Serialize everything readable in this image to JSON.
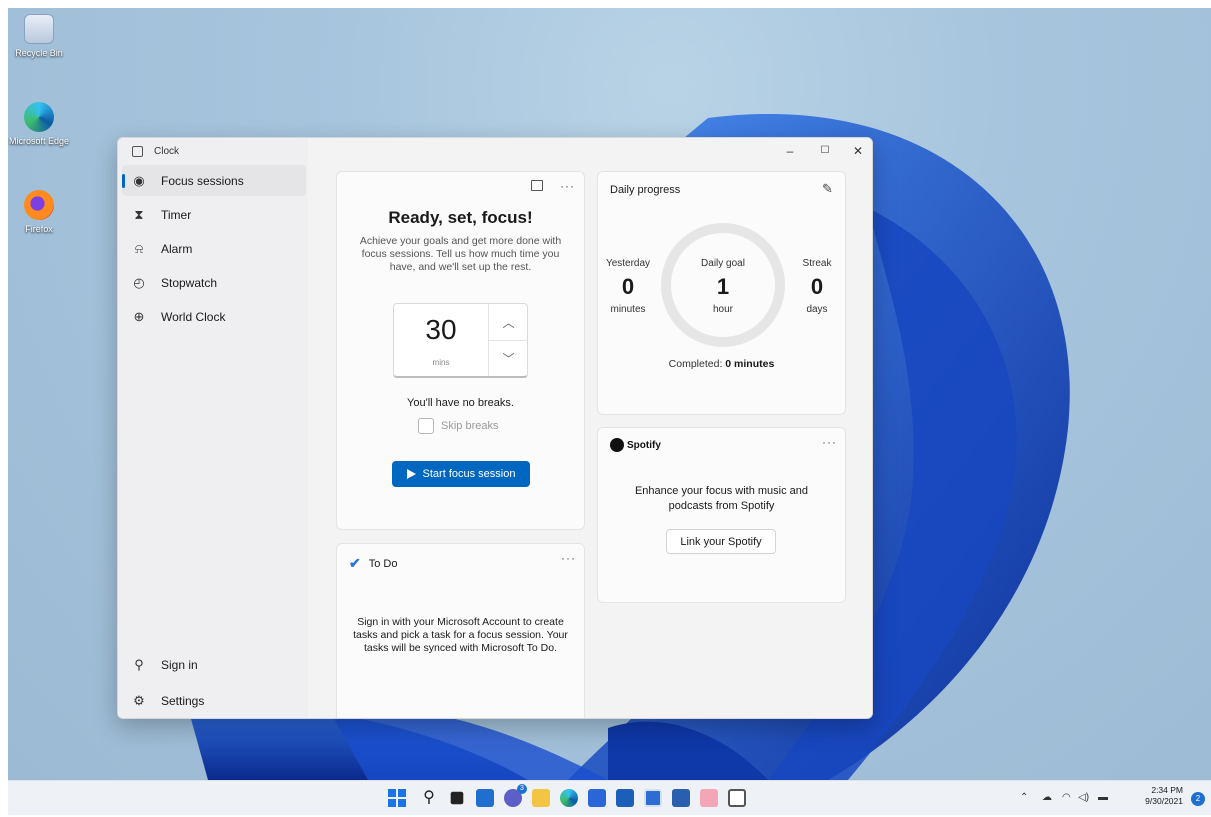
{
  "desktop": {
    "icons": [
      {
        "label": "Recycle Bin",
        "icon": "recycle-bin-icon"
      },
      {
        "label": "Microsoft Edge",
        "icon": "edge-icon"
      },
      {
        "label": "Firefox",
        "icon": "firefox-icon"
      }
    ]
  },
  "window": {
    "app_title": "Clock",
    "controls": {
      "minimize": "–",
      "maximize": "☐",
      "close": "✕"
    }
  },
  "sidebar": {
    "items": [
      {
        "label": "Focus sessions",
        "icon": "focus-icon",
        "active": true
      },
      {
        "label": "Timer",
        "icon": "hourglass-icon"
      },
      {
        "label": "Alarm",
        "icon": "bell-icon"
      },
      {
        "label": "Stopwatch",
        "icon": "stopwatch-icon"
      },
      {
        "label": "World Clock",
        "icon": "globe-icon"
      }
    ],
    "bottom": [
      {
        "label": "Sign in",
        "icon": "person-icon"
      },
      {
        "label": "Settings",
        "icon": "gear-icon"
      }
    ]
  },
  "focus": {
    "title": "Ready, set, focus!",
    "description": "Achieve your goals and get more done with focus sessions. Tell us how much time you have, and we'll set up the rest.",
    "minutes": "30",
    "unit": "mins",
    "breaks_text": "You'll have no breaks.",
    "skip_label": "Skip breaks",
    "start_label": "Start focus session"
  },
  "progress": {
    "title": "Daily progress",
    "yesterday": {
      "label": "Yesterday",
      "value": "0",
      "unit": "minutes"
    },
    "goal": {
      "label": "Daily goal",
      "value": "1",
      "unit": "hour"
    },
    "streak": {
      "label": "Streak",
      "value": "0",
      "unit": "days"
    },
    "completed_prefix": "Completed: ",
    "completed_value": "0 minutes"
  },
  "spotify": {
    "brand": "Spotify",
    "description": "Enhance your focus with music and podcasts from Spotify",
    "link_label": "Link your Spotify"
  },
  "todo": {
    "title": "To Do",
    "description": "Sign in with your Microsoft Account to create tasks and pick a task for a focus session. Your tasks will be synced with Microsoft To Do."
  },
  "taskbar": {
    "time": "2:34 PM",
    "date": "9/30/2021",
    "notification_count": "2",
    "chat_badge": "3"
  },
  "colors": {
    "accent": "#0067c0",
    "wallpaper_bloom": "#1e53c8"
  }
}
